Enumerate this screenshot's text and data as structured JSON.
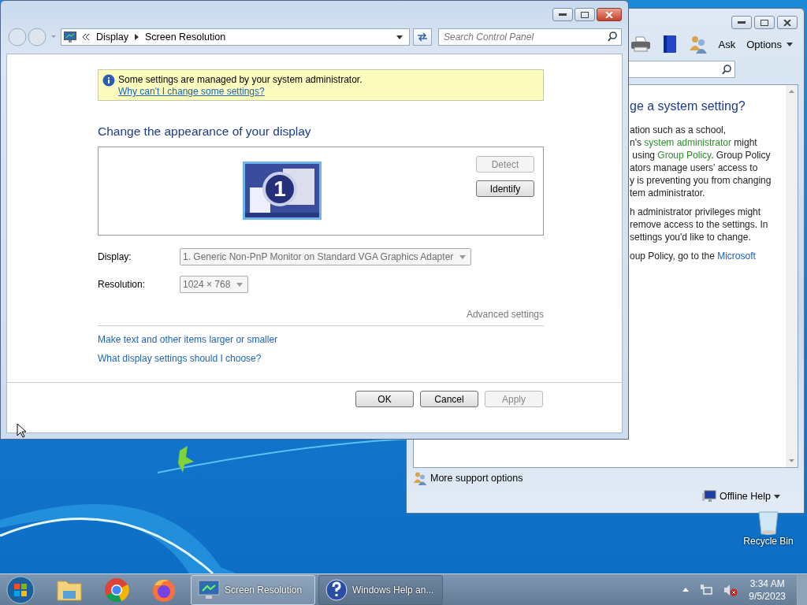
{
  "main_window": {
    "breadcrumb": [
      "Display",
      "Screen Resolution"
    ],
    "search": {
      "placeholder": "Search Control Panel"
    },
    "notice": {
      "text": "Some settings are managed by your system administrator.",
      "link": "Why can't I change some settings?"
    },
    "heading": "Change the appearance of your display",
    "monitor_number": "1",
    "monitor_buttons": [
      {
        "label": "Detect",
        "disabled": true
      },
      {
        "label": "Identify",
        "disabled": false
      }
    ],
    "fields": [
      {
        "label": "Display:",
        "value": "1. Generic Non-PnP Monitor on Standard VGA Graphics Adapter",
        "disabled": true
      },
      {
        "label": "Resolution:",
        "value": "1024 × 768",
        "disabled": true
      }
    ],
    "advanced": {
      "label": "Advanced settings",
      "disabled": true
    },
    "links": [
      "Make text and other items larger or smaller",
      "What display settings should I choose?"
    ],
    "buttons": [
      {
        "label": "OK",
        "disabled": false
      },
      {
        "label": "Cancel",
        "disabled": false
      },
      {
        "label": "Apply",
        "disabled": true
      }
    ]
  },
  "help_window": {
    "ask": "Ask",
    "options": "Options",
    "heading": "ge a system setting?",
    "paragraphs": [
      [
        [
          {
            "text": "ation such as a school,"
          }
        ],
        [
          {
            "text": "n's "
          },
          {
            "text": "system administrator",
            "link": true
          },
          {
            "text": " might"
          }
        ],
        [
          {
            "text": " using "
          },
          {
            "text": "Group Policy",
            "link": true
          },
          {
            "text": ". Group Policy"
          }
        ],
        [
          {
            "text": "ators manage users' access to"
          }
        ],
        [
          {
            "text": "y is preventing you from changing"
          }
        ],
        [
          {
            "text": "tem administrator."
          }
        ]
      ],
      [
        [
          {
            "text": "h administrator privileges might"
          }
        ],
        [
          {
            "text": "remove access to the settings. In"
          }
        ],
        [
          {
            "text": "settings you'd like to change."
          }
        ]
      ],
      [
        [
          {
            "text": "oup Policy, go to the "
          },
          {
            "text": "Microsoft",
            "link": true,
            "blue": true
          }
        ]
      ]
    ],
    "more_support": "More support options",
    "offline": "Offline Help"
  },
  "desktop": {
    "icons": [
      {
        "label": "Recycle Bin"
      }
    ]
  },
  "taskbar": {
    "tasks": [
      {
        "label": "Screen Resolution",
        "selected": true,
        "kind": "display"
      },
      {
        "label": "Windows Help an...",
        "selected": false,
        "kind": "help"
      }
    ],
    "time": "3:34 AM",
    "date": "9/5/2023"
  }
}
